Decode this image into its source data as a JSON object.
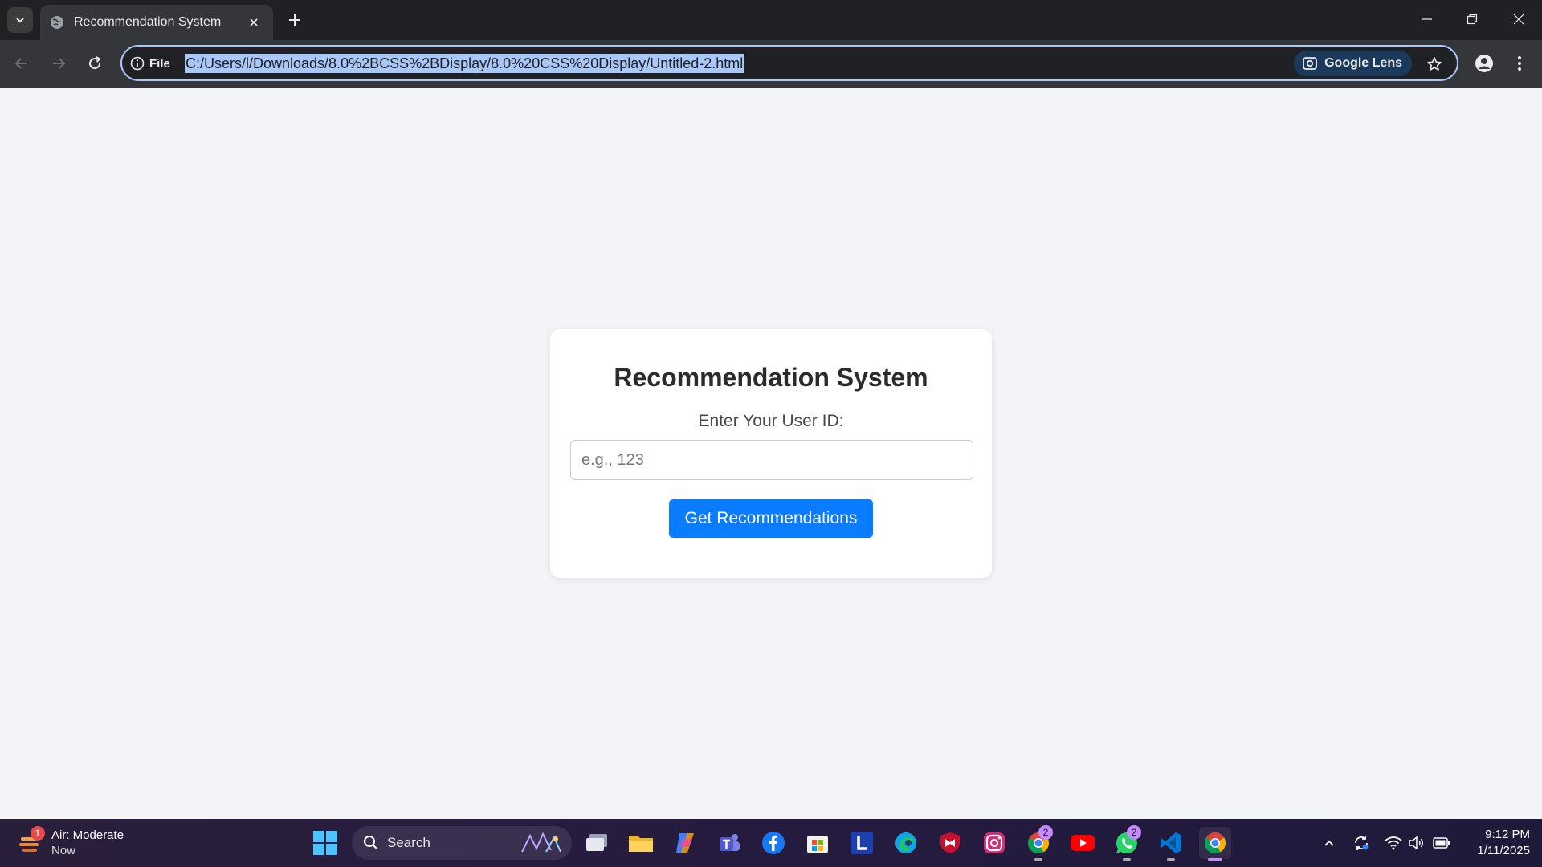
{
  "browser": {
    "tab_title": "Recommendation System",
    "site_chip_label": "File",
    "url": "C:/Users/l/Downloads/8.0%2BCSS%2BDisplay/8.0%20CSS%20Display/Untitled-2.html",
    "lens_label": "Google Lens"
  },
  "page": {
    "title": "Recommendation System",
    "input_label": "Enter Your User ID:",
    "input_placeholder": "e.g., 123",
    "input_value": "",
    "button_label": "Get Recommendations",
    "accent_color": "#0a7cff"
  },
  "taskbar": {
    "weather_title": "Air: Moderate",
    "weather_sub": "Now",
    "weather_badge": "1",
    "search_label": "Search",
    "chrome_badge": "2",
    "whatsapp_badge": "2",
    "time": "9:12 PM",
    "date": "1/11/2025"
  }
}
